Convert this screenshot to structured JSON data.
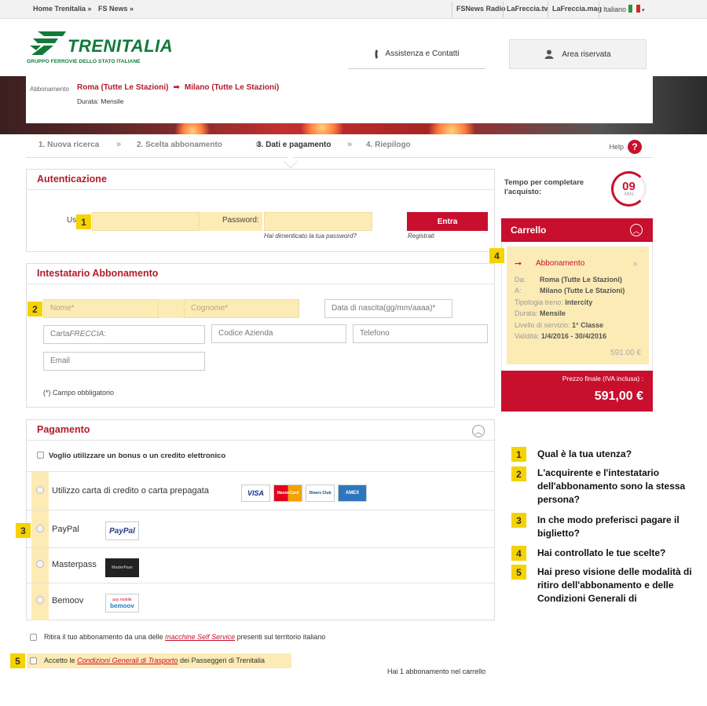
{
  "topbar": {
    "home": "Home Trenitalia",
    "fsnews": "FS News",
    "right": [
      "FSNews Radio",
      "LaFreccia.tv",
      "LaFreccia.mag"
    ],
    "language": "Italiano",
    "chevron": "»"
  },
  "header": {
    "logo_text": "TRENITALIA",
    "logo_sub": "GRUPPO FERROVIE DELLO STATO ITALIANE",
    "assist": "Assistenza e Contatti",
    "area": "Area riservata"
  },
  "summary": {
    "label": "Abbonamento",
    "from": "Roma (Tutte Le Stazioni)",
    "to": "Milano (Tutte Le Stazioni)",
    "duration": "Durata: Mensile"
  },
  "steps": {
    "items": [
      "1. Nuova ricerca",
      "2. Scelta abbonamento",
      "3. Dati e pagamento",
      "4. Riepilogo"
    ],
    "sep": "»",
    "help": "Help",
    "help_icon": "?"
  },
  "auth": {
    "title": "Autenticazione",
    "user_label": "Us",
    "password_label": "Password:",
    "forgot": "Hai dimenticato la tua password?",
    "enter": "Entra",
    "register": "Registrati"
  },
  "holder": {
    "title": "Intestatario Abbonamento",
    "name": "Nome*",
    "surname": "Cognome*",
    "birth": "Data di nascita(gg/mm/aaaa)*",
    "card_prefix": "Carta",
    "card_brand": "FRECCIA",
    "card_suffix": ":",
    "company": "Codice Azienda",
    "phone": "Telefono",
    "email": "Email",
    "required": "(*) Campo obbligatorio"
  },
  "payment": {
    "title": "Pagamento",
    "bonus": "Voglio utilizzare un bonus o un credito elettronico",
    "methods": [
      "Utilizzo carta di credito o carta prepagata",
      "PayPal",
      "Masterpass",
      "Bemoov"
    ],
    "card_logos": [
      "VISA",
      "MasterCard",
      "Diners Club",
      "AMEX"
    ],
    "paypal_logo": "PayPal",
    "masterpass_logo": "MasterPass",
    "bemoov_logo_small": "pay mobile",
    "bemoov_logo": "bemoov"
  },
  "footer_opts": {
    "selfservice_pre": "Ritira il tuo abbonamento da una delle ",
    "selfservice_link": "macchine Self Service",
    "selfservice_post": " presenti sul territorio italiano",
    "accept_pre": "Accetto le ",
    "accept_link": "Condizioni Generali di Trasporto",
    "accept_post": " dei Passeggeri di Trenitalia",
    "cart_count": "Hai 1 abbonamento nel carrello"
  },
  "timer": {
    "label": "Tempo per completare l'acquisto:",
    "value": "09",
    "unit": "MIN"
  },
  "cart": {
    "title": "Carrello",
    "item_title": "Abbonamento",
    "rows": [
      {
        "k": "Da:",
        "v": "Roma (Tutte Le Stazioni)"
      },
      {
        "k": "A:",
        "v": "Milano (Tutte Le Stazioni)"
      },
      {
        "k": "Tipologia treno:",
        "v": "Intercity"
      },
      {
        "k": "Durata:",
        "v": "Mensile"
      },
      {
        "k": "Livello di servizio:",
        "v": "1° Classe"
      },
      {
        "k": "Validità:",
        "v": "1/4/2016 - 30/4/2016"
      }
    ],
    "item_price": "591.00 €",
    "final_label": "Prezzo finale (IVA inclusa) :",
    "final_price": "591,00 €"
  },
  "markers": [
    "1",
    "2",
    "3",
    "4",
    "5"
  ],
  "questions": [
    {
      "n": "1",
      "text": "Qual è la tua utenza?"
    },
    {
      "n": "2",
      "text": "L'acquirente e l'intestatario dell'abbonamento sono la stessa persona?"
    },
    {
      "n": "3",
      "text": "In che modo preferisci pagare il biglietto?"
    },
    {
      "n": "4",
      "text": "Hai controllato le tue scelte?"
    },
    {
      "n": "5",
      "text": "Hai preso visione delle modalità di ritiro dell'abbonamento e delle Condizioni Generali di"
    }
  ],
  "colors": {
    "brand_red": "#c8102e",
    "brand_green": "#117a3a",
    "highlight": "#fcebb5",
    "marker": "#f6d200"
  }
}
